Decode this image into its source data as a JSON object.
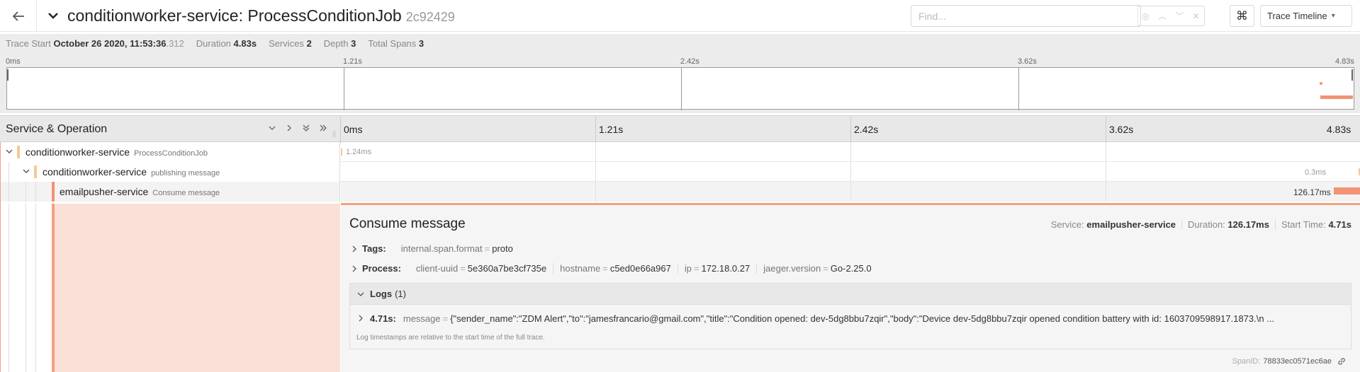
{
  "header": {
    "service": "conditionworker-service",
    "operation": "ProcessConditionJob",
    "title_sep": ": ",
    "trace_id": "2c92429",
    "find_placeholder": "Find...",
    "kbd_icon": "⌘",
    "view_label": "Trace Timeline"
  },
  "summary": {
    "trace_start_label": "Trace Start",
    "trace_start_value": "October 26 2020, 11:53:36",
    "trace_start_ms": ".312",
    "duration_label": "Duration",
    "duration_value": "4.83s",
    "services_label": "Services",
    "services_value": "2",
    "depth_label": "Depth",
    "depth_value": "3",
    "total_spans_label": "Total Spans",
    "total_spans_value": "3"
  },
  "minimap": {
    "ticks": [
      "0ms",
      "1.21s",
      "2.42s",
      "3.62s",
      "4.83s"
    ]
  },
  "timeline_header": {
    "label": "Service & Operation",
    "ticks": [
      "0ms",
      "1.21s",
      "2.42s",
      "3.62s",
      "4.83s"
    ]
  },
  "spans": [
    {
      "service": "conditionworker-service",
      "operation": "ProcessConditionJob",
      "duration": "1.24ms",
      "start_fraction": 0.0,
      "duration_fraction": 0.0003
    },
    {
      "service": "conditionworker-service",
      "operation": "publishing message",
      "duration": "0.3ms",
      "start_fraction": 0.9996,
      "duration_fraction": 0.0001
    },
    {
      "service": "emailpusher-service",
      "operation": "Consume message",
      "duration": "126.17ms",
      "start_fraction": 0.974,
      "duration_fraction": 0.026
    }
  ],
  "detail": {
    "title": "Consume message",
    "service_label": "Service:",
    "service_value": "emailpusher-service",
    "duration_label": "Duration:",
    "duration_value": "126.17ms",
    "start_label": "Start Time:",
    "start_value": "4.71s",
    "tags_label": "Tags:",
    "tags": [
      {
        "key": "internal.span.format",
        "value": "proto"
      }
    ],
    "process_label": "Process:",
    "process": [
      {
        "key": "client-uuid",
        "value": "5e360a7be3cf735e"
      },
      {
        "key": "hostname",
        "value": "c5ed0e66a967"
      },
      {
        "key": "ip",
        "value": "172.18.0.27"
      },
      {
        "key": "jaeger.version",
        "value": "Go-2.25.0"
      }
    ],
    "logs_label": "Logs",
    "logs_count": "(1)",
    "log_time": "4.71s:",
    "log_key": "message",
    "log_value": "{\"sender_name\":\"ZDM Alert\",\"to\":\"jamesfrancario@gmail.com\",\"title\":\"Condition opened: dev-5dg8bbu7zqir\",\"body\":\"Device dev-5dg8bbu7zqir opened condition battery with id: 1603709598917.1873.\\n ...",
    "log_note": "Log timestamps are relative to the start time of the full trace.",
    "spanid_label": "SpanID:",
    "spanid_value": "78833ec0571ec6ae"
  }
}
